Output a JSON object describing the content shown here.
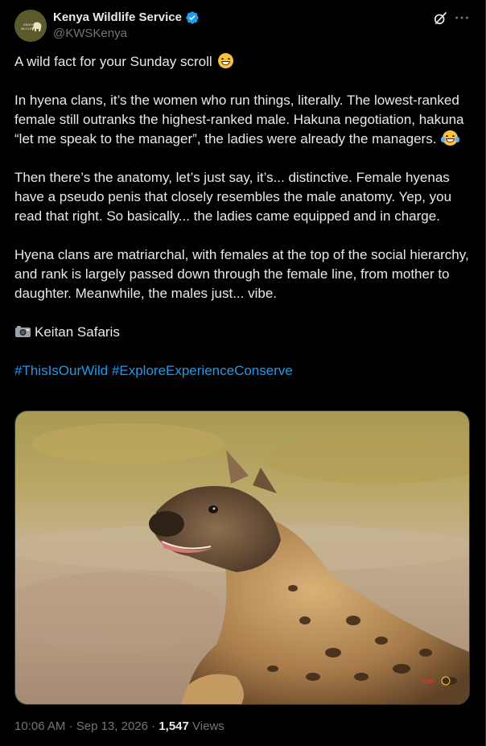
{
  "author": {
    "display_name": "Kenya Wildlife Service",
    "handle": "@KWSKenya",
    "verified": true,
    "avatar_icon": "kws-elephant-logo",
    "avatar_color": "#5b5a2c",
    "verified_color": "#1d9bf0"
  },
  "actions": {
    "grok_icon": "grok-icon",
    "more_icon": "more-horizontal-icon"
  },
  "tweet": {
    "line1": "A wild fact for your Sunday scroll",
    "emoji1": "grinning-face",
    "para2": "In hyena clans, it’s the women who run things, literally. The lowest-ranked female still outranks the highest-ranked male. Hakuna negotiation, hakuna “let me speak to the manager”, the ladies were already the managers.",
    "emoji2": "face-with-tears-of-joy",
    "para3": "Then there’s the anatomy, let’s just say, it’s... distinctive.  Female hyenas have a pseudo penis that closely resembles the male anatomy. Yep, you read that right. So basically... the ladies came equipped and in charge.",
    "para4": "Hyena clans are matriarchal, with females at the top of the social hierarchy, and rank is largely passed down through the female line, from mother to daughter. Meanwhile, the males just... vibe.",
    "credit_icon": "camera-icon",
    "credit": "Keitan Safaris",
    "hashtags": [
      "#ThisIsOurWild",
      "#ExploreExperienceConserve"
    ]
  },
  "media": {
    "description_icon": "hyena-photo",
    "accent": "#c79a5d"
  },
  "meta": {
    "time": "10:06 AM",
    "separator": "·",
    "date": "Sep 13, 2026",
    "views_count": "1,547",
    "views_label": "Views"
  },
  "colors": {
    "background": "#000000",
    "text": "#e7e9ea",
    "muted": "#71767b",
    "link": "#1d9bf0"
  }
}
